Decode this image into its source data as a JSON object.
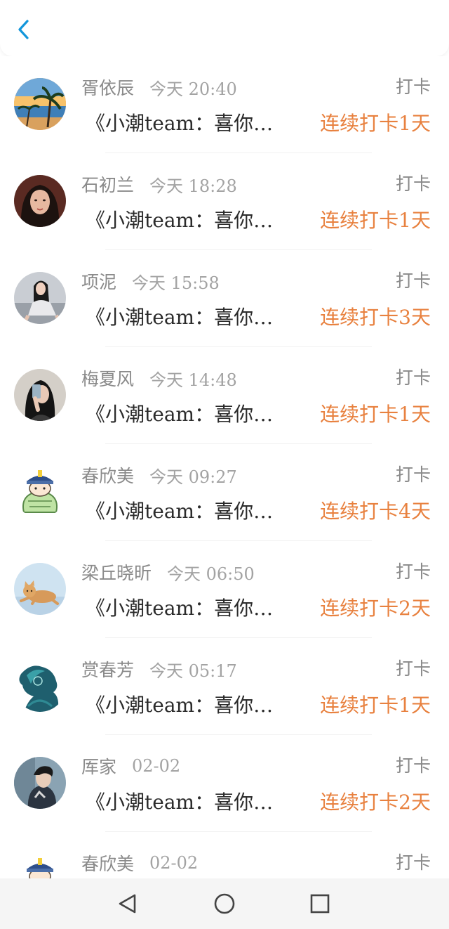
{
  "header": {
    "back_icon": "chevron-left-icon",
    "accent": "#1296db"
  },
  "records": [
    {
      "name": "胥依辰",
      "time": "今天 20:40",
      "kind": "打卡",
      "message": "《小潮team：喜你…",
      "streak": "连续打卡1天",
      "avatar": "beach-sunset"
    },
    {
      "name": "石初兰",
      "time": "今天 18:28",
      "kind": "打卡",
      "message": "《小潮team：喜你…",
      "streak": "连续打卡1天",
      "avatar": "woman-portrait"
    },
    {
      "name": "项泥",
      "time": "今天 15:58",
      "kind": "打卡",
      "message": "《小潮team：喜你…",
      "streak": "连续打卡3天",
      "avatar": "woman-sitting"
    },
    {
      "name": "梅夏风",
      "time": "今天 14:48",
      "kind": "打卡",
      "message": "《小潮team：喜你…",
      "streak": "连续打卡1天",
      "avatar": "woman-selfie"
    },
    {
      "name": "春欣美",
      "time": "今天 09:27",
      "kind": "打卡",
      "message": "《小潮team：喜你…",
      "streak": "连续打卡4天",
      "avatar": "cartoon-official"
    },
    {
      "name": "梁丘晓昕",
      "time": "今天 06:50",
      "kind": "打卡",
      "message": "《小潮team：喜你…",
      "streak": "连续打卡2天",
      "avatar": "cat-lying"
    },
    {
      "name": "赏春芳",
      "time": "今天 05:17",
      "kind": "打卡",
      "message": "《小潮team：喜你…",
      "streak": "连续打卡1天",
      "avatar": "silhouette-teal"
    },
    {
      "name": "厍家",
      "time": "02-02",
      "kind": "打卡",
      "message": "《小潮team：喜你…",
      "streak": "连续打卡2天",
      "avatar": "man-portrait"
    },
    {
      "name": "春欣美",
      "time": "02-02",
      "kind": "打卡",
      "message": "",
      "streak": "",
      "avatar": "cartoon-official"
    }
  ],
  "colors": {
    "name": "#8a8a8a",
    "time": "#a3a3a3",
    "message": "#2b2b2b",
    "streak": "#e8813f"
  },
  "navbar": {
    "buttons": [
      "back-triangle-icon",
      "home-circle-icon",
      "recents-square-icon"
    ]
  }
}
